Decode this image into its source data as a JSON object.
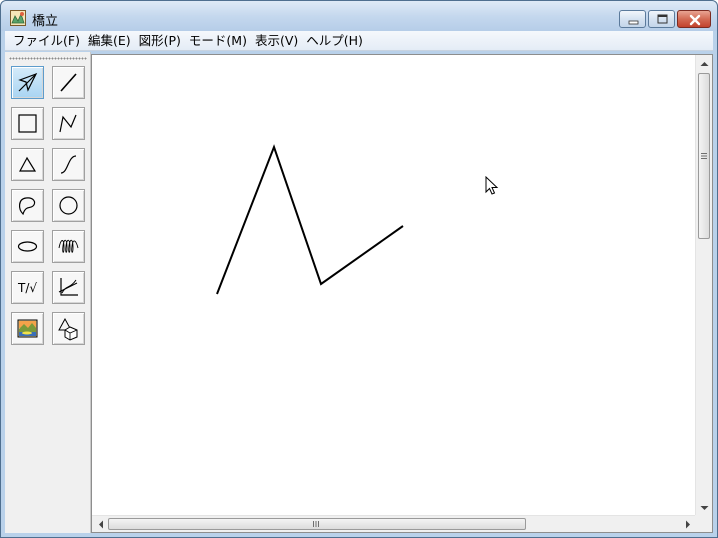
{
  "window": {
    "title": "橋立"
  },
  "menubar": {
    "items": [
      {
        "label": "ファイル(F)"
      },
      {
        "label": "編集(E)"
      },
      {
        "label": "図形(P)"
      },
      {
        "label": "モード(M)"
      },
      {
        "label": "表示(V)"
      },
      {
        "label": "ヘルプ(H)"
      }
    ]
  },
  "toolbox": {
    "text_tool_label": "T/√",
    "tools": [
      {
        "icon": "select-arrow-icon",
        "active": true
      },
      {
        "icon": "line-icon"
      },
      {
        "icon": "rectangle-icon"
      },
      {
        "icon": "polyline-icon"
      },
      {
        "icon": "triangle-icon"
      },
      {
        "icon": "curve-icon"
      },
      {
        "icon": "freeform-shape-icon"
      },
      {
        "icon": "circle-icon"
      },
      {
        "icon": "ellipse-icon"
      },
      {
        "icon": "spring-coil-icon"
      },
      {
        "icon": "text-formula-icon"
      },
      {
        "icon": "graph-axes-icon"
      },
      {
        "icon": "image-icon"
      },
      {
        "icon": "shapes-3d-icon"
      }
    ]
  },
  "colors": {
    "active_tool": "#a9d4f2",
    "close_button": "#c2422c",
    "stroke": "#000000"
  }
}
